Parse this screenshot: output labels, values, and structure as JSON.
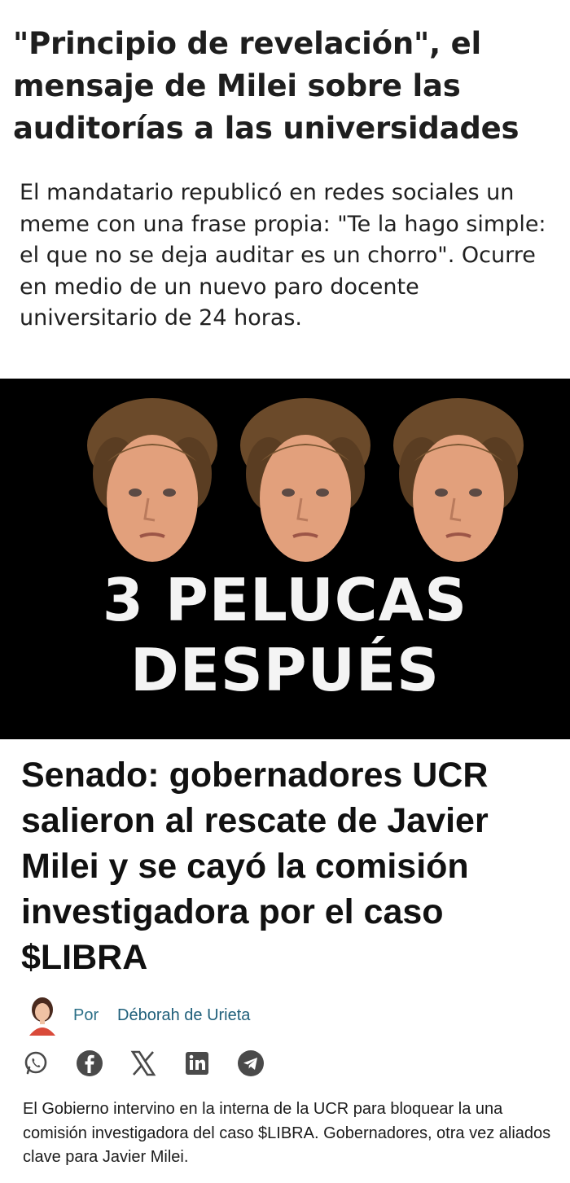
{
  "article1": {
    "headline": "\"Principio de revelación\", el mensaje de Milei sobre las auditorías a las universidades",
    "lead": "El mandatario republicó en redes sociales un meme con una frase propia: \"Te la hago simple: el que no se deja auditar es un chorro\". Ocurre en medio de un nuevo paro docente universitario de 24 horas."
  },
  "meme": {
    "line1": "3 PELUCAS",
    "line2": "DESPUÉS",
    "background": "#000000"
  },
  "article2": {
    "headline": "Senado: gobernadores UCR salieron al rescate de Javier Milei y se cayó la comisión investigadora por el caso $LIBRA",
    "byline_prefix": "Por",
    "author": "Déborah de Urieta",
    "share_icons": [
      "whatsapp-icon",
      "facebook-icon",
      "x-icon",
      "linkedin-icon",
      "telegram-icon"
    ],
    "lead": "El Gobierno intervino en la interna de la UCR para bloquear la una comisión investigadora del caso $LIBRA. Gobernadores, otra vez aliados clave para Javier Milei."
  },
  "colors": {
    "author_link": "#1f5f7a",
    "share_icon": "#4a4a4a"
  }
}
